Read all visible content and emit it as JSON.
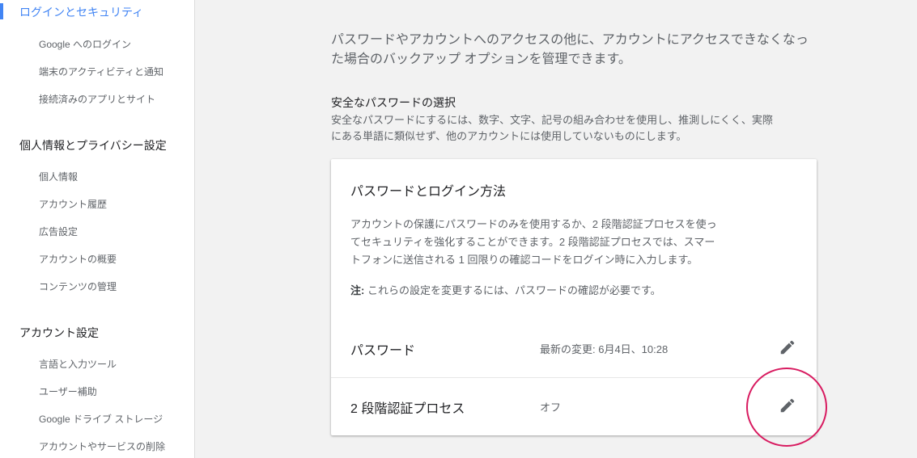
{
  "sidebar": {
    "active_item": "ログインとセキュリティ",
    "security_items": [
      "Google へのログイン",
      "端末のアクティビティと通知",
      "接続済みのアプリとサイト"
    ],
    "privacy_heading": "個人情報とプライバシー設定",
    "privacy_items": [
      "個人情報",
      "アカウント履歴",
      "広告設定",
      "アカウントの概要",
      "コンテンツの管理"
    ],
    "account_heading": "アカウント設定",
    "account_items": [
      "言語と入力ツール",
      "ユーザー補助",
      "Google ドライブ ストレージ",
      "アカウントやサービスの削除"
    ]
  },
  "main": {
    "intro_line1": "パスワードやアカウントへのアクセスの他に、アカウントにアクセスできなくなっ",
    "intro_line2": "た場合のバックアップ オプションを管理できます。",
    "section_title": "安全なパスワードの選択",
    "section_desc_line1": "安全なパスワードにするには、数字、文字、記号の組み合わせを使用し、推測しにくく、実際",
    "section_desc_line2": "にある単語に類似せず、他のアカウントには使用していないものにします。"
  },
  "card": {
    "title": "パスワードとログイン方法",
    "desc_line1": "アカウントの保護にパスワードのみを使用するか、2 段階認証プロセスを使っ",
    "desc_line2": "てセキュリティを強化することができます。2 段階認証プロセスでは、スマー",
    "desc_line3": "トフォンに送信される 1 回限りの確認コードをログイン時に入力します。",
    "note_label": "注:",
    "note_text": " これらの設定を変更するには、パスワードの確認が必要です。",
    "rows": [
      {
        "label": "パスワード",
        "value": "最新の変更: 6月4日、10:28",
        "icon": "pencil-icon"
      },
      {
        "label": "2 段階認証プロセス",
        "value": "オフ",
        "icon": "pencil-icon"
      }
    ]
  },
  "colors": {
    "accent": "#4285f4",
    "highlight": "#d81b60"
  }
}
